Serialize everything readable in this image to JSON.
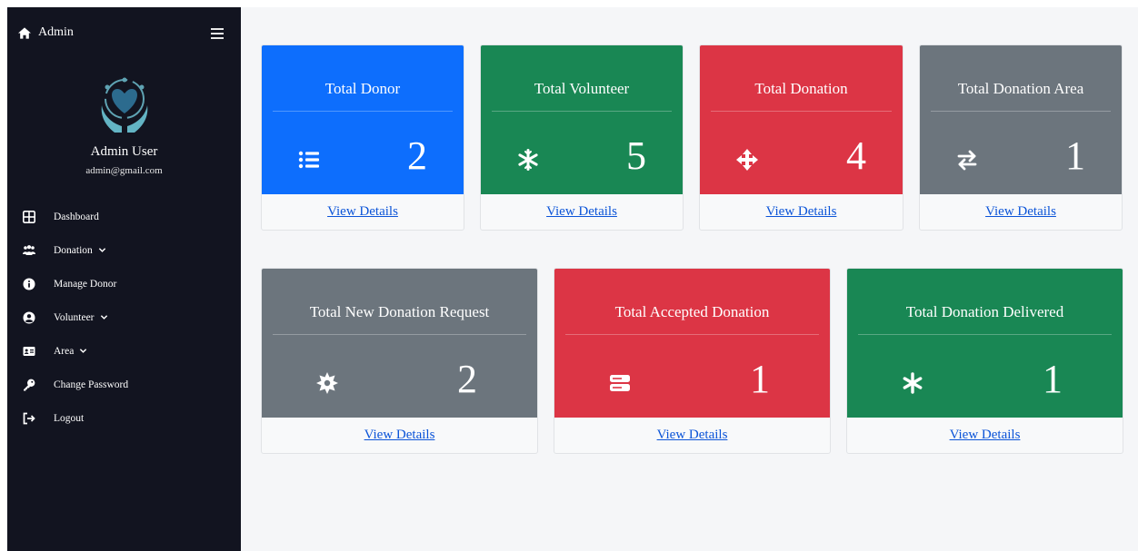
{
  "sidebar": {
    "brand": "Admin",
    "user_name": "Admin User",
    "user_email": "admin@gmail.com",
    "items": [
      {
        "label": "Dashboard",
        "icon": "grid-icon"
      },
      {
        "label": "Donation",
        "icon": "users-icon",
        "has_dropdown": true
      },
      {
        "label": "Manage Donor",
        "icon": "info-circle-icon"
      },
      {
        "label": "Volunteer",
        "icon": "user-circle-icon",
        "has_dropdown": true
      },
      {
        "label": "Area",
        "icon": "id-card-icon",
        "has_dropdown": true
      },
      {
        "label": "Change Password",
        "icon": "key-icon"
      },
      {
        "label": "Logout",
        "icon": "logout-icon"
      }
    ]
  },
  "cards": [
    {
      "title": "Total Donor",
      "value": "2",
      "icon": "list-icon",
      "color": "#0d6efd",
      "link": "View Details"
    },
    {
      "title": "Total Volunteer",
      "value": "5",
      "icon": "snowflake-icon",
      "color": "#198754",
      "link": "View Details"
    },
    {
      "title": "Total Donation",
      "value": "4",
      "icon": "move-arrows-icon",
      "color": "#dc3545",
      "link": "View Details"
    },
    {
      "title": "Total Donation Area",
      "value": "1",
      "icon": "exchange-arrows-icon",
      "color": "#6c757d",
      "link": "View Details"
    },
    {
      "title": "Total New Donation Request",
      "value": "2",
      "icon": "burst-icon",
      "color": "#6c757d",
      "link": "View Details"
    },
    {
      "title": "Total Accepted Donation",
      "value": "1",
      "icon": "server-icon",
      "color": "#dc3545",
      "link": "View Details"
    },
    {
      "title": "Total Donation Delivered",
      "value": "1",
      "icon": "asterisk-icon",
      "color": "#198754",
      "link": "View Details"
    }
  ],
  "colors": {
    "sidebar_bg": "#121420",
    "main_bg": "#f5f6f8",
    "link": "#0b54d8"
  }
}
